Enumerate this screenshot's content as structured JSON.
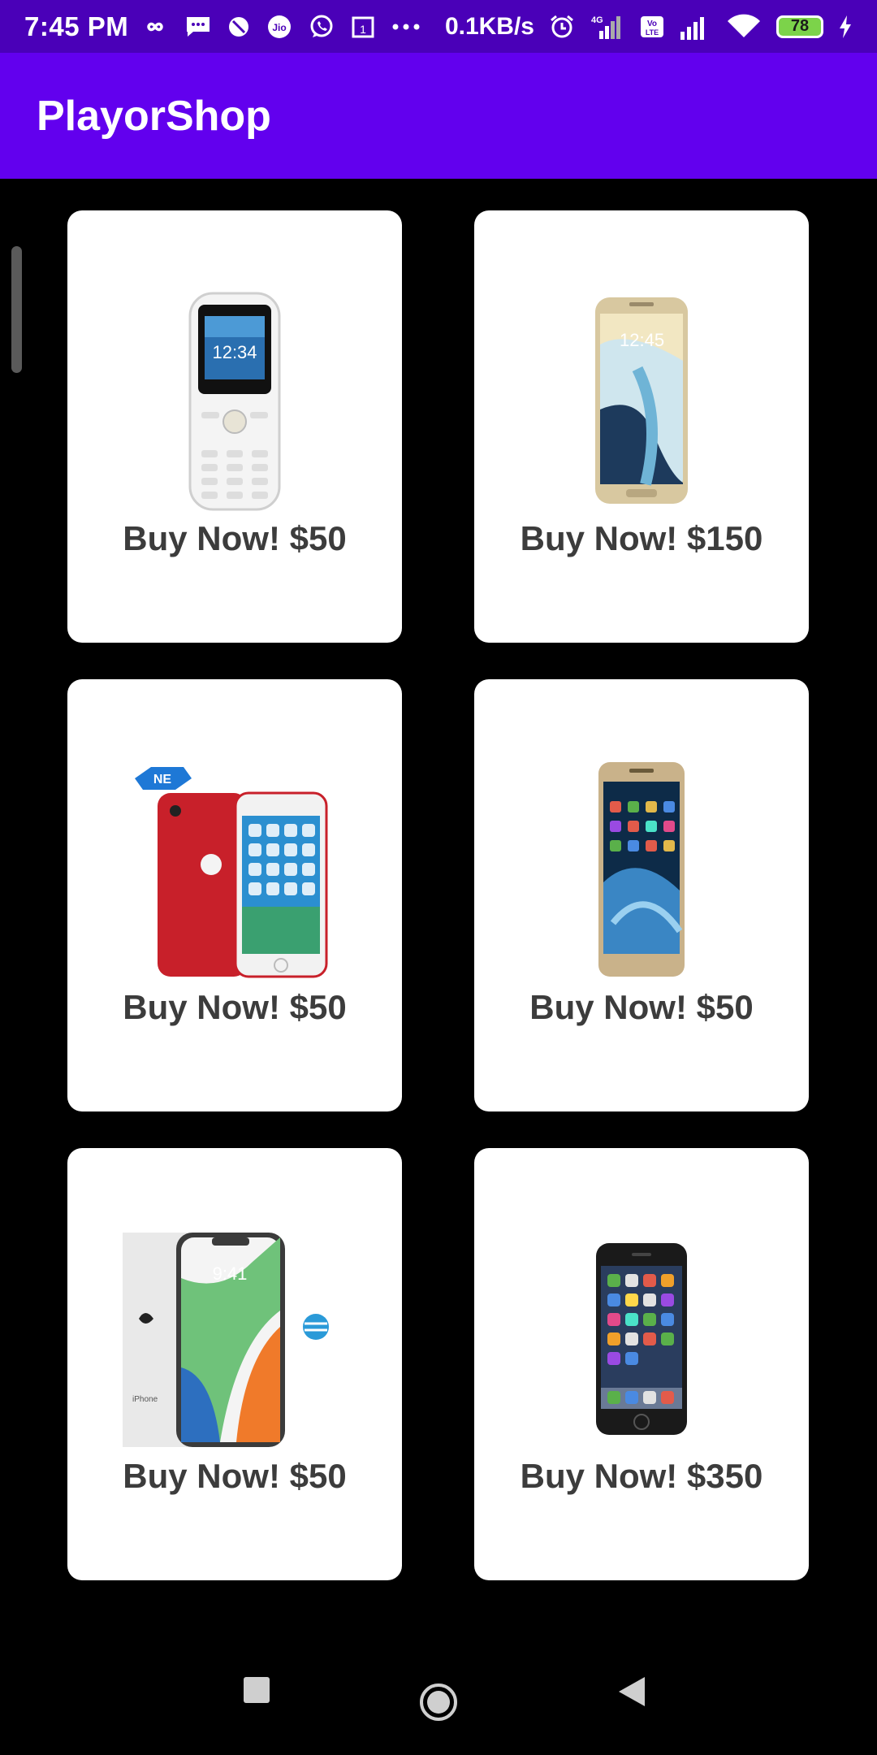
{
  "status_bar": {
    "time": "7:45 PM",
    "network_speed": "0.1KB/s",
    "network_type": "4G",
    "volte": "Vo LTE",
    "battery_level": "78",
    "notifications": [
      "infinity-icon",
      "message-icon",
      "dnd-icon",
      "jio-icon",
      "whatsapp-icon",
      "calendar-icon",
      "more-icon"
    ],
    "calendar_number": "1"
  },
  "app_bar": {
    "title": "PlayorShop",
    "background": "#6200ee"
  },
  "products": [
    {
      "label": "Buy Now! $50",
      "image": "feature-phone-icon"
    },
    {
      "label": "Buy Now! $150",
      "image": "galaxy-edge-phone-icon"
    },
    {
      "label": "Buy Now! $50",
      "image": "red-iphone-pair-icon"
    },
    {
      "label": "Buy Now! $50",
      "image": "gold-android-phone-icon"
    },
    {
      "label": "Buy Now! $50",
      "image": "iphone-x-icon"
    },
    {
      "label": "Buy Now! $350",
      "image": "iphone-6-icon"
    }
  ],
  "colors": {
    "status_bar": "#4a00b8",
    "background": "#000000",
    "card": "#ffffff",
    "label_text": "#3c3c3c"
  }
}
